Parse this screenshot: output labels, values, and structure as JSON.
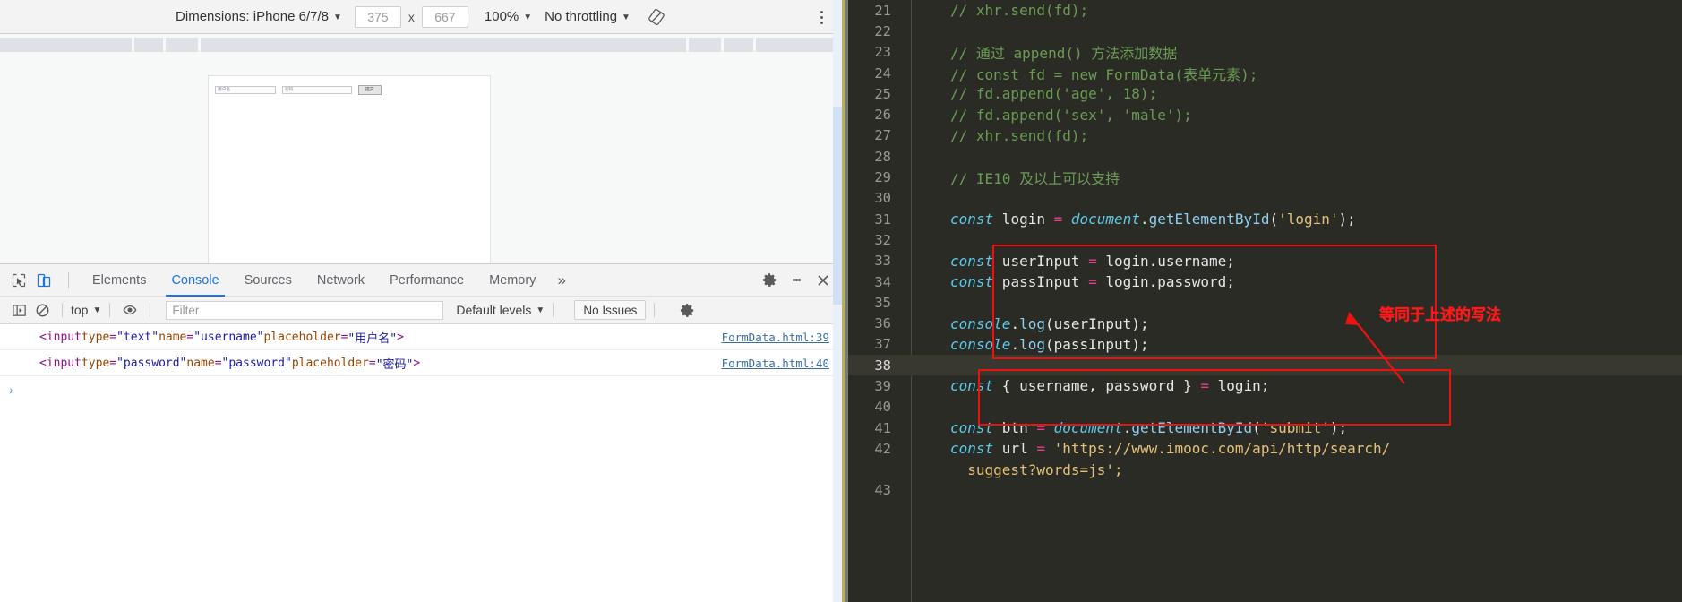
{
  "device_toolbar": {
    "dimensions_label": "Dimensions: iPhone 6/7/8",
    "width_value": "375",
    "x_label": "x",
    "height_value": "667",
    "zoom_label": "100%",
    "throttling_label": "No throttling",
    "rotate_icon": "rotate-device-icon",
    "menu_icon": "more-options-icon",
    "caret": "▼"
  },
  "device_preview": {
    "username_placeholder": "用户名",
    "password_placeholder": "密码",
    "submit_label": "提交"
  },
  "tabbar": {
    "inspect_icon": "inspect-element-icon",
    "device_toggle_icon": "toggle-device-toolbar-icon",
    "tabs": [
      {
        "label": "Elements",
        "active": false
      },
      {
        "label": "Console",
        "active": true
      },
      {
        "label": "Sources",
        "active": false
      },
      {
        "label": "Network",
        "active": false
      },
      {
        "label": "Performance",
        "active": false
      },
      {
        "label": "Memory",
        "active": false
      }
    ],
    "more_tabs": "»",
    "settings_icon": "gear-icon",
    "more_icon": "kebab-menu-icon",
    "close_icon": "close-icon"
  },
  "console_toolbar": {
    "sidebar_icon": "console-sidebar-icon",
    "clear_icon": "clear-console-icon",
    "context_label": "top",
    "eye_icon": "live-expression-icon",
    "filter_placeholder": "Filter",
    "filter_value": "",
    "levels_label": "Default levels",
    "issues_label": "No Issues",
    "settings_icon": "gear-icon",
    "caret": "▼"
  },
  "console_messages": [
    {
      "parts": [
        {
          "t": "<input ",
          "c": "tok-tag"
        },
        {
          "t": "type",
          "c": "tok-attr"
        },
        {
          "t": "=",
          "c": "tok-pun"
        },
        {
          "t": "\"text\"",
          "c": "tok-val"
        },
        {
          "t": " ",
          "c": "tok-pun"
        },
        {
          "t": "name",
          "c": "tok-attr"
        },
        {
          "t": "=",
          "c": "tok-pun"
        },
        {
          "t": "\"username\"",
          "c": "tok-val"
        },
        {
          "t": " ",
          "c": "tok-pun"
        },
        {
          "t": "placeholder",
          "c": "tok-attr"
        },
        {
          "t": "=",
          "c": "tok-pun"
        },
        {
          "t": "\"用户名\"",
          "c": "tok-val"
        },
        {
          "t": ">",
          "c": "tok-tag"
        }
      ],
      "source": "FormData.html:39"
    },
    {
      "parts": [
        {
          "t": "<input ",
          "c": "tok-tag"
        },
        {
          "t": "type",
          "c": "tok-attr"
        },
        {
          "t": "=",
          "c": "tok-pun"
        },
        {
          "t": "\"password\"",
          "c": "tok-val"
        },
        {
          "t": " ",
          "c": "tok-pun"
        },
        {
          "t": "name",
          "c": "tok-attr"
        },
        {
          "t": "=",
          "c": "tok-pun"
        },
        {
          "t": "\"password\"",
          "c": "tok-val"
        },
        {
          "t": " ",
          "c": "tok-pun"
        },
        {
          "t": "placeholder",
          "c": "tok-attr"
        },
        {
          "t": "=",
          "c": "tok-pun"
        },
        {
          "t": "\"密码\"",
          "c": "tok-val"
        },
        {
          "t": ">",
          "c": "tok-tag"
        }
      ],
      "source": "FormData.html:40"
    }
  ],
  "console_prompt": "›",
  "editor": {
    "active_line": 38,
    "annotation": "等同于上述的写法",
    "annotation_color": "#ff1a1a",
    "lines": [
      {
        "n": 21,
        "parts": [
          {
            "t": "// xhr.send(fd);",
            "c": "c-comment"
          }
        ]
      },
      {
        "n": 22,
        "parts": []
      },
      {
        "n": 23,
        "parts": [
          {
            "t": "// 通过 append() 方法添加数据",
            "c": "c-comment"
          }
        ]
      },
      {
        "n": 24,
        "parts": [
          {
            "t": "// const fd = new FormData(表单元素);",
            "c": "c-comment"
          }
        ]
      },
      {
        "n": 25,
        "parts": [
          {
            "t": "// fd.append('age', 18);",
            "c": "c-comment"
          }
        ]
      },
      {
        "n": 26,
        "parts": [
          {
            "t": "// fd.append('sex', 'male');",
            "c": "c-comment"
          }
        ]
      },
      {
        "n": 27,
        "parts": [
          {
            "t": "// xhr.send(fd);",
            "c": "c-comment"
          }
        ]
      },
      {
        "n": 28,
        "parts": []
      },
      {
        "n": 29,
        "parts": [
          {
            "t": "// IE10 及以上可以支持",
            "c": "c-comment"
          }
        ]
      },
      {
        "n": 30,
        "parts": []
      },
      {
        "n": 31,
        "parts": [
          {
            "t": "const",
            "c": "c-kw"
          },
          {
            "t": " login ",
            "c": "c-plain"
          },
          {
            "t": "=",
            "c": "c-op"
          },
          {
            "t": " ",
            "c": "c-plain"
          },
          {
            "t": "document",
            "c": "c-obj"
          },
          {
            "t": ".",
            "c": "c-punc"
          },
          {
            "t": "getElementById",
            "c": "c-fn"
          },
          {
            "t": "(",
            "c": "c-punc"
          },
          {
            "t": "'login'",
            "c": "c-str"
          },
          {
            "t": ");",
            "c": "c-punc"
          }
        ]
      },
      {
        "n": 32,
        "parts": []
      },
      {
        "n": 33,
        "parts": [
          {
            "t": "const",
            "c": "c-kw"
          },
          {
            "t": " userInput ",
            "c": "c-plain"
          },
          {
            "t": "=",
            "c": "c-op"
          },
          {
            "t": " login.username;",
            "c": "c-plain"
          }
        ]
      },
      {
        "n": 34,
        "parts": [
          {
            "t": "const",
            "c": "c-kw"
          },
          {
            "t": " passInput ",
            "c": "c-plain"
          },
          {
            "t": "=",
            "c": "c-op"
          },
          {
            "t": " login.password;",
            "c": "c-plain"
          }
        ]
      },
      {
        "n": 35,
        "parts": []
      },
      {
        "n": 36,
        "parts": [
          {
            "t": "console",
            "c": "c-obj"
          },
          {
            "t": ".",
            "c": "c-punc"
          },
          {
            "t": "log",
            "c": "c-fn"
          },
          {
            "t": "(userInput);",
            "c": "c-plain"
          }
        ]
      },
      {
        "n": 37,
        "parts": [
          {
            "t": "console",
            "c": "c-obj"
          },
          {
            "t": ".",
            "c": "c-punc"
          },
          {
            "t": "log",
            "c": "c-fn"
          },
          {
            "t": "(passInput);",
            "c": "c-plain"
          }
        ]
      },
      {
        "n": 38,
        "parts": []
      },
      {
        "n": 39,
        "parts": [
          {
            "t": "const",
            "c": "c-kw"
          },
          {
            "t": " { username, password } ",
            "c": "c-plain"
          },
          {
            "t": "=",
            "c": "c-op"
          },
          {
            "t": " login;",
            "c": "c-plain"
          }
        ]
      },
      {
        "n": 40,
        "parts": []
      },
      {
        "n": 41,
        "parts": [
          {
            "t": "const",
            "c": "c-kw"
          },
          {
            "t": " btn ",
            "c": "c-plain"
          },
          {
            "t": "=",
            "c": "c-op"
          },
          {
            "t": " ",
            "c": "c-plain"
          },
          {
            "t": "document",
            "c": "c-obj"
          },
          {
            "t": ".",
            "c": "c-punc"
          },
          {
            "t": "getElementById",
            "c": "c-fn"
          },
          {
            "t": "(",
            "c": "c-punc"
          },
          {
            "t": "'submit'",
            "c": "c-str"
          },
          {
            "t": ");",
            "c": "c-punc"
          }
        ]
      },
      {
        "n": 42,
        "parts": [
          {
            "t": "const",
            "c": "c-kw"
          },
          {
            "t": " url ",
            "c": "c-plain"
          },
          {
            "t": "=",
            "c": "c-op"
          },
          {
            "t": " ",
            "c": "c-plain"
          },
          {
            "t": "'https://www.imooc.com/api/http/search/",
            "c": "c-str"
          }
        ]
      },
      {
        "n": "",
        "parts": [
          {
            "t": "  suggest?words=js';",
            "c": "c-str"
          }
        ]
      },
      {
        "n": 43,
        "parts": []
      }
    ]
  }
}
